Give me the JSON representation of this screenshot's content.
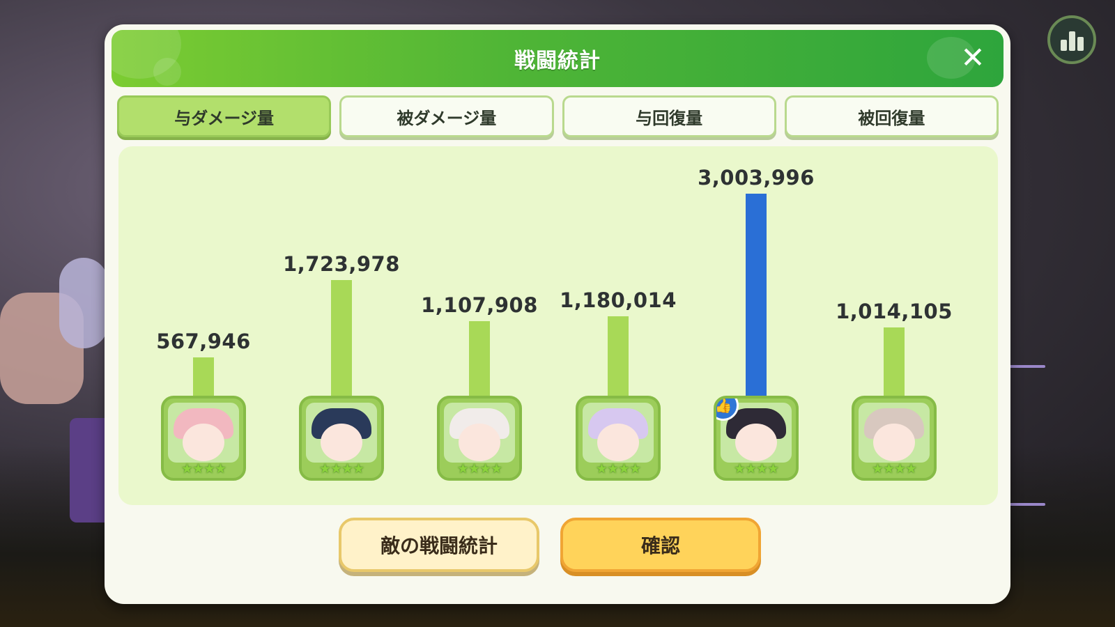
{
  "header": {
    "title": "戦闘統計",
    "close_icon": "close-icon"
  },
  "tabs": [
    {
      "label": "与ダメージ量",
      "active": true
    },
    {
      "label": "被ダメージ量",
      "active": false
    },
    {
      "label": "与回復量",
      "active": false
    },
    {
      "label": "被回復量",
      "active": false
    }
  ],
  "chart_data": {
    "type": "bar",
    "categories": [
      "",
      "",
      "",
      "",
      "",
      ""
    ],
    "values": [
      567946,
      1723978,
      1107908,
      1180014,
      3003996,
      1014105
    ],
    "value_labels": [
      "567,946",
      "1,723,978",
      "1,107,908",
      "1,180,014",
      "3,003,996",
      "1,014,105"
    ],
    "highlight_index": 4,
    "colors": {
      "bar": "#a8d957",
      "highlight": "#2a6fd6"
    }
  },
  "characters": [
    {
      "stars": "★★★★",
      "hair_color": "#f2b8c0",
      "bg_color": "#c7e8a4"
    },
    {
      "stars": "★★★★",
      "hair_color": "#2a3a5a",
      "bg_color": "#c7e8a4"
    },
    {
      "stars": "★★★★",
      "hair_color": "#f1ecea",
      "bg_color": "#c7e8a4"
    },
    {
      "stars": "★★★★",
      "hair_color": "#d7c8f0",
      "bg_color": "#c7e8a4"
    },
    {
      "stars": "★★★★",
      "hair_color": "#2e2a36",
      "bg_color": "#c7e8a4",
      "mvp_icon": "thumbs-up-icon"
    },
    {
      "stars": "★★★★",
      "hair_color": "#d8c8bf",
      "bg_color": "#c7e8a4"
    }
  ],
  "buttons": {
    "enemy_stats": "敵の戦闘統計",
    "confirm": "確認"
  },
  "hud": {
    "stats_icon": "bar-chart-icon"
  }
}
